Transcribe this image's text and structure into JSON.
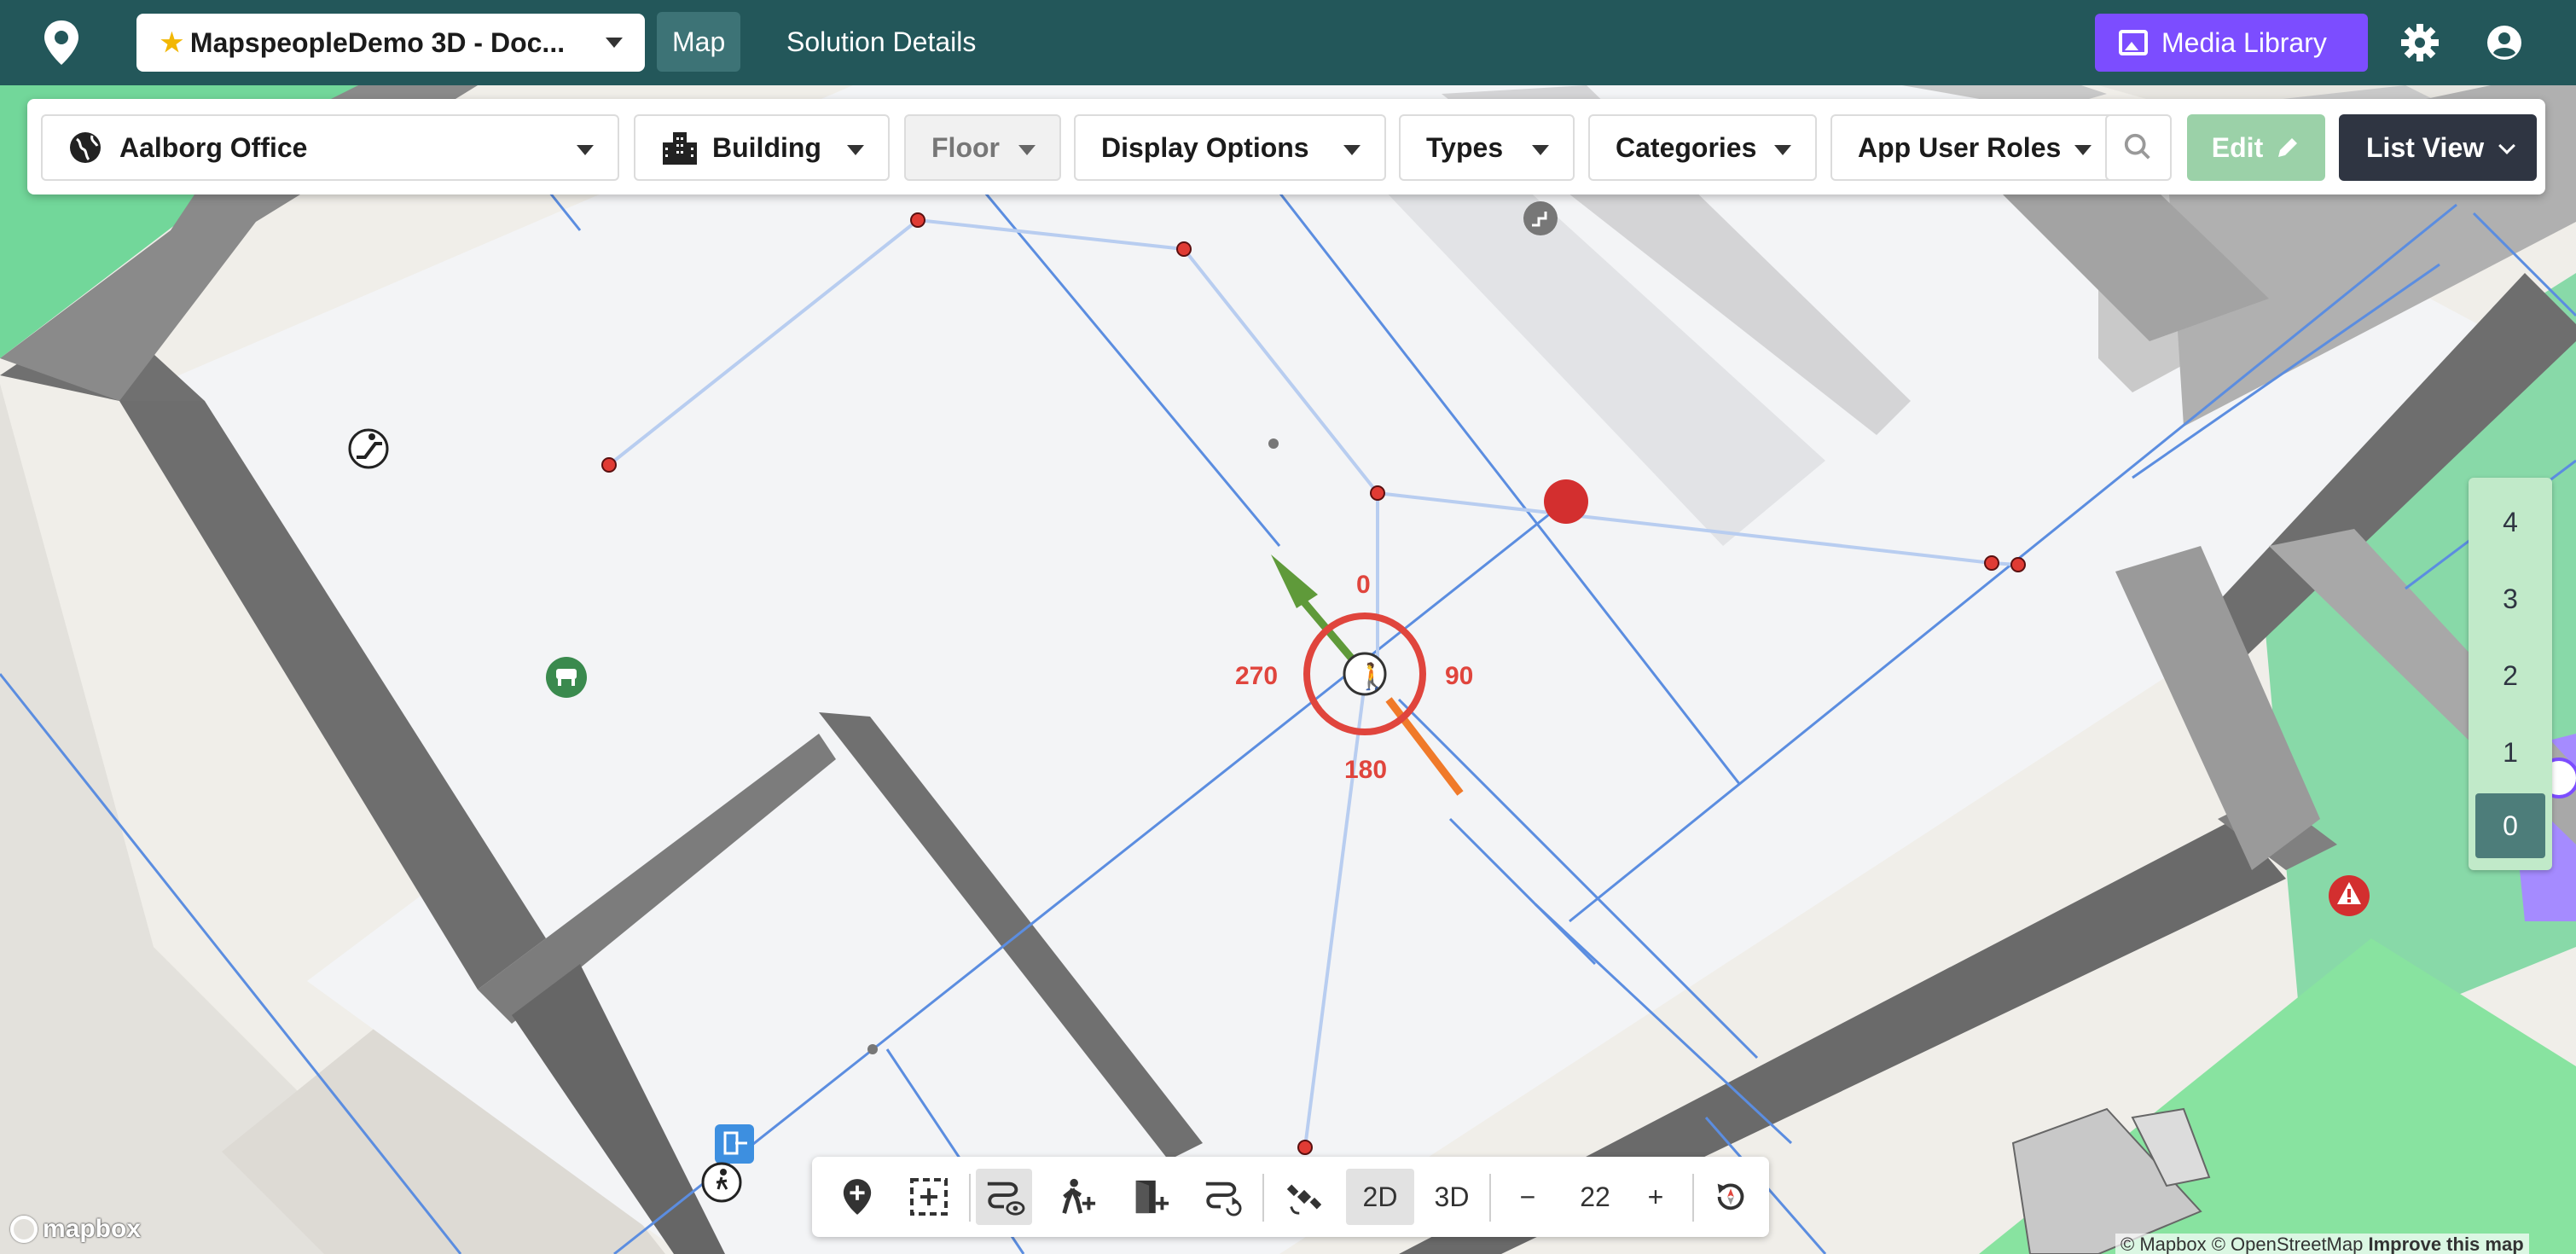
{
  "nav": {
    "solution_name": "MapspeopleDemo 3D - Doc...",
    "tabs": [
      {
        "label": "Map",
        "active": true
      },
      {
        "label": "Solution Details",
        "active": false
      }
    ],
    "media_library_label": "Media Library",
    "colors": {
      "nav_bg": "#23575a",
      "media_button": "#7c4dff"
    }
  },
  "toolbar": {
    "venue_label": "Aalborg Office",
    "building_label": "Building",
    "floor_label": "Floor",
    "display_options_label": "Display Options",
    "types_label": "Types",
    "categories_label": "Categories",
    "app_user_roles_label": "App User Roles",
    "edit_label": "Edit",
    "list_view_label": "List View"
  },
  "map": {
    "compass_labels": {
      "north": "0",
      "east": "90",
      "south": "180",
      "west": "270"
    },
    "icons": [
      "escalator-icon",
      "seating-icon",
      "exit-icon",
      "pedestrian-icon",
      "warning-icon"
    ]
  },
  "floors": [
    {
      "label": "4",
      "active": false
    },
    {
      "label": "3",
      "active": false
    },
    {
      "label": "2",
      "active": false
    },
    {
      "label": "1",
      "active": false
    },
    {
      "label": "0",
      "active": true
    }
  ],
  "bottom_bar": {
    "mode_2d_label": "2D",
    "mode_3d_label": "3D",
    "zoom_out_label": "−",
    "zoom_level": "22",
    "zoom_in_label": "+"
  },
  "attribution": {
    "mapbox_text": "© Mapbox",
    "osm_text": "© OpenStreetMap",
    "improve_text": "Improve this map",
    "logo_text": "mapbox"
  }
}
